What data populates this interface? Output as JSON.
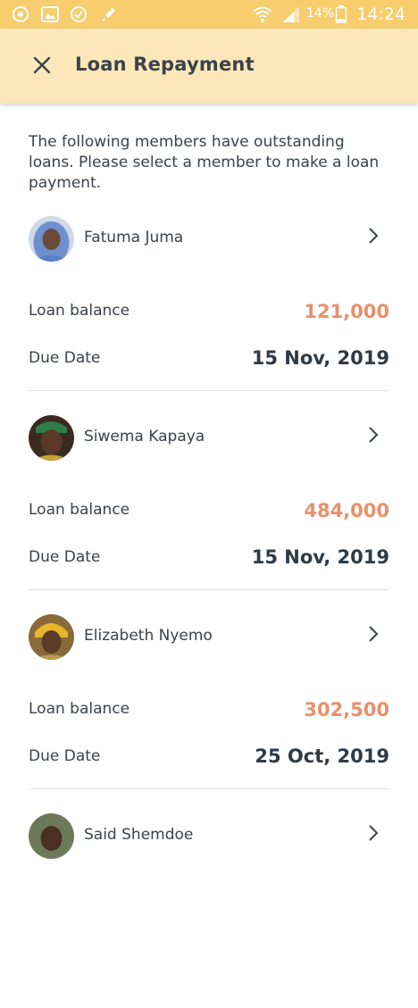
{
  "status_bar": {
    "battery": "14%",
    "time": "14:24"
  },
  "header": {
    "title": "Loan Repayment",
    "close_icon": "close-icon"
  },
  "intro": "The following members have outstanding loans. Please select a member to make a loan payment.",
  "labels": {
    "loan_balance": "Loan balance",
    "due_date": "Due Date"
  },
  "colors": {
    "status_bar": "#f7cd6e",
    "app_bar": "#fbe7b9",
    "balance": "#e8906a",
    "text": "#3b4249"
  },
  "members": [
    {
      "name": "Fatuma Juma",
      "loan_balance": "121,000",
      "due_date": "15 Nov, 2019"
    },
    {
      "name": "Siwema Kapaya",
      "loan_balance": "484,000",
      "due_date": "15 Nov, 2019"
    },
    {
      "name": "Elizabeth Nyemo",
      "loan_balance": "302,500",
      "due_date": "25 Oct, 2019"
    },
    {
      "name": "Said Shemdoe"
    }
  ]
}
